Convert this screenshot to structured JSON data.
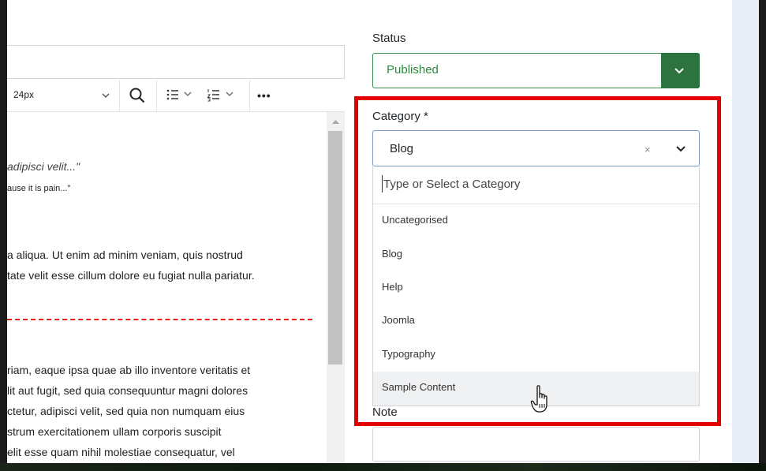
{
  "editor": {
    "font_size": "24px",
    "quote_line_1": "adipisci velit...\"",
    "quote_line_2": "ause it is pain...\"",
    "para1": [
      "a aliqua. Ut enim ad minim veniam, quis nostrud",
      "tate velit esse cillum dolore eu fugiat nulla pariatur."
    ],
    "para2": [
      "riam, eaque ipsa quae ab illo inventore veritatis et",
      "lit aut fugit, sed quia consequuntur magni dolores",
      "ctetur, adipisci velit, sed quia non numquam eius",
      "strum exercitationem ullam corporis suscipit",
      "elit esse quam nihil molestiae consequatur, vel"
    ]
  },
  "sidebar": {
    "status_label": "Status",
    "status_value": "Published",
    "category_label": "Category *",
    "category_value": "Blog",
    "clear_symbol": "×",
    "category_search_placeholder": "Type or Select a Category",
    "category_options": [
      "Uncategorised",
      "Blog",
      "Help",
      "Joomla",
      "Typography",
      "Sample Content"
    ],
    "hovered_option": "Sample Content",
    "note_label": "Note",
    "note_value": ""
  },
  "colors": {
    "status_green": "#2c7340",
    "highlight_red": "#e50000",
    "divider_red": "#e11e1e"
  },
  "icons": [
    "search-icon",
    "bullet-list-icon",
    "numbered-list-icon",
    "more-icon",
    "chevron-down-icon",
    "hand-pointer-icon"
  ]
}
